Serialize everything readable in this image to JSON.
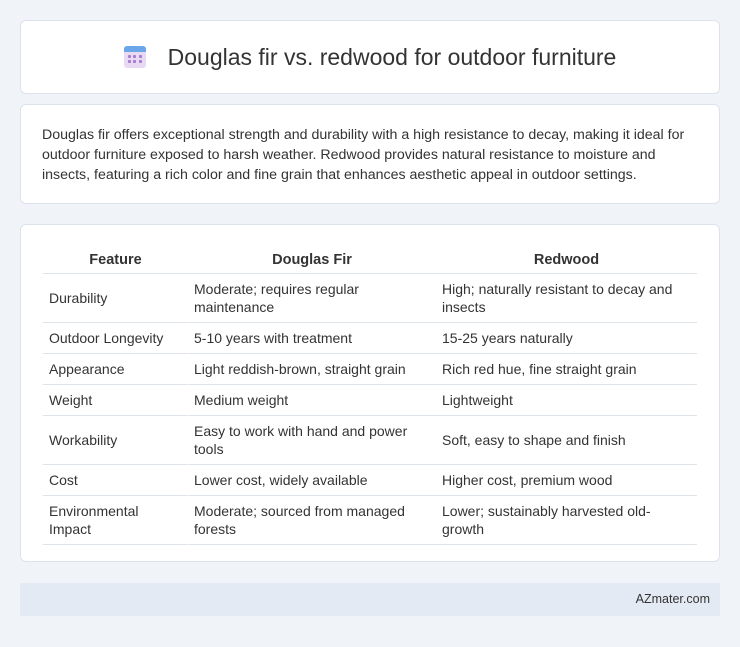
{
  "header": {
    "title": "Douglas fir vs. redwood for outdoor furniture",
    "icon": "calendar-icon"
  },
  "summary": {
    "text": "Douglas fir offers exceptional strength and durability with a high resistance to decay, making it ideal for outdoor furniture exposed to harsh weather. Redwood provides natural resistance to moisture and insects, featuring a rich color and fine grain that enhances aesthetic appeal in outdoor settings."
  },
  "table": {
    "headers": [
      "Feature",
      "Douglas Fir",
      "Redwood"
    ],
    "rows": [
      [
        "Durability",
        "Moderate; requires regular maintenance",
        "High; naturally resistant to decay and insects"
      ],
      [
        "Outdoor Longevity",
        "5-10 years with treatment",
        "15-25 years naturally"
      ],
      [
        "Appearance",
        "Light reddish-brown, straight grain",
        "Rich red hue, fine straight grain"
      ],
      [
        "Weight",
        "Medium weight",
        "Lightweight"
      ],
      [
        "Workability",
        "Easy to work with hand and power tools",
        "Soft, easy to shape and finish"
      ],
      [
        "Cost",
        "Lower cost, widely available",
        "Higher cost, premium wood"
      ],
      [
        "Environmental Impact",
        "Moderate; sourced from managed forests",
        "Lower; sustainably harvested old-growth"
      ]
    ]
  },
  "footer": {
    "text": "AZmater.com"
  }
}
